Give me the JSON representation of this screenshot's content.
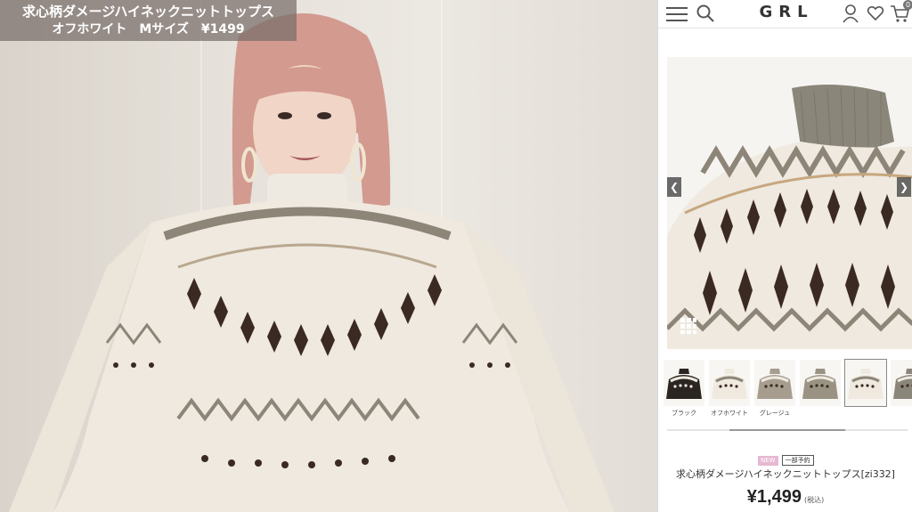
{
  "video": {
    "caption_line1": "求心柄ダメージハイネックニットトップス",
    "caption_line2": "オフホワイト　Mサイズ　¥1499"
  },
  "shop": {
    "logo": "GRL",
    "cart_count": "0",
    "thumbnails": [
      {
        "label": "ブラック",
        "selected": false
      },
      {
        "label": "オフホワイト",
        "selected": false
      },
      {
        "label": "グレージュ",
        "selected": false
      },
      {
        "label": "",
        "selected": false
      },
      {
        "label": "",
        "selected": true
      },
      {
        "label": "",
        "selected": false
      }
    ],
    "badge_new": "NEW",
    "badge_preorder": "一部予約",
    "product_name": "求心柄ダメージハイネックニットトップス[zi332]",
    "price": "¥1,499",
    "tax_note": "(税込)",
    "colors": {
      "text": "#333333",
      "badge_new": "#e6b8d2",
      "knit_cream": "#efe9df",
      "knit_brown": "#3b2a22",
      "knit_taupe": "#8d8578"
    }
  }
}
